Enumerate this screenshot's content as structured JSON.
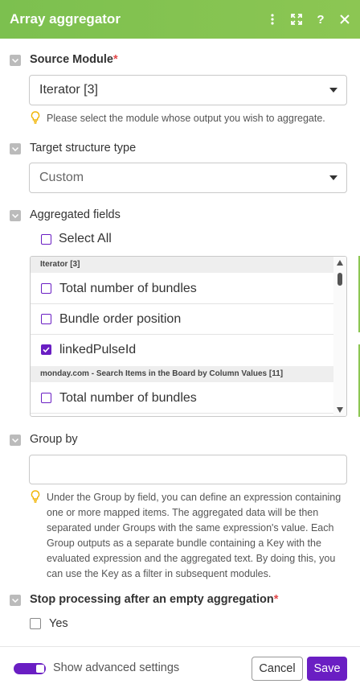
{
  "header": {
    "title": "Array aggregator",
    "icons": [
      "more-vert-icon",
      "expand-icon",
      "help-icon",
      "close-icon"
    ],
    "color": "#7cc04f"
  },
  "source_module": {
    "label": "Source Module",
    "required_mark": "*",
    "value": "Iterator [3]",
    "hint": "Please select the module whose output you wish to aggregate."
  },
  "target_structure": {
    "label": "Target structure type",
    "value": "Custom"
  },
  "aggregated_fields": {
    "label": "Aggregated fields",
    "select_all": "Select All",
    "groups": [
      {
        "name": "Iterator [3]"
      },
      {
        "name": "monday.com - Search Items in the Board by Column Values [11]"
      }
    ],
    "items": [
      {
        "label": "Total number of bundles",
        "checked": false
      },
      {
        "label": "Bundle order position",
        "checked": false
      },
      {
        "label": "linkedPulseId",
        "checked": true
      },
      {
        "label": "Total number of bundles",
        "checked": false
      }
    ]
  },
  "group_by": {
    "label": "Group by",
    "value": "",
    "hint": "Under the Group by field, you can define an expression containing one or more mapped items. The aggregated data will be then separated under Groups with the same expression's value. Each Group outputs as a separate bundle containing a Key with the evaluated expression and the aggregated text. By doing this, you can use the Key as a filter in subsequent modules."
  },
  "stop_processing": {
    "label": "Stop processing after an empty aggregation",
    "required_mark": "*",
    "option": "Yes"
  },
  "footer": {
    "advanced_label": "Show advanced settings",
    "cancel": "Cancel",
    "save": "Save",
    "accent": "#6a1ec3"
  }
}
